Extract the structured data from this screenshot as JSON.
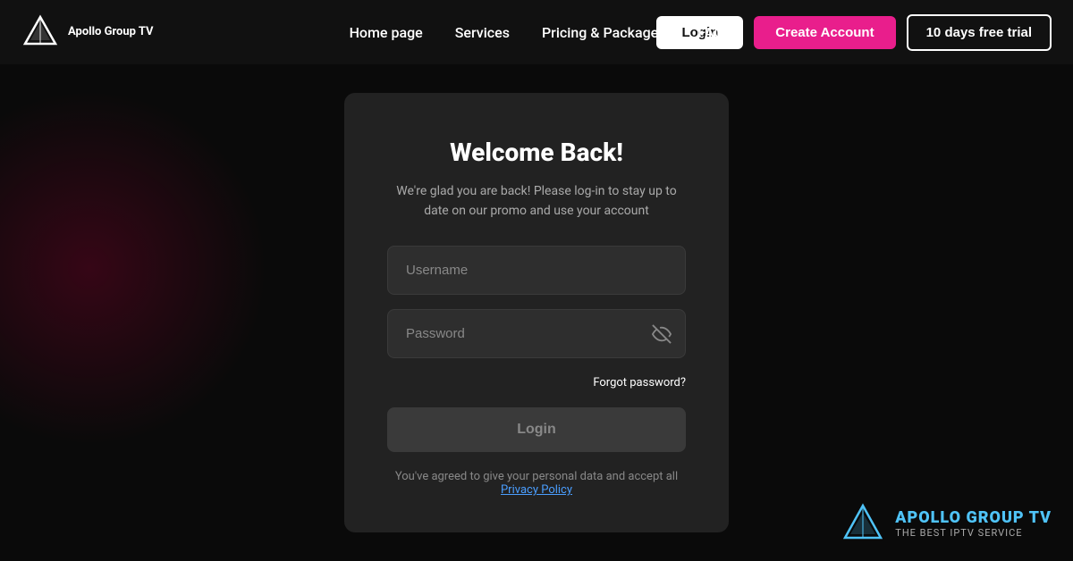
{
  "navbar": {
    "logo_text_line1": "Apollo Group TV",
    "logo_text_line2": "",
    "nav_items": [
      {
        "label": "Home page",
        "id": "home"
      },
      {
        "label": "Services",
        "id": "services"
      },
      {
        "label": "Pricing & Packages",
        "id": "pricing"
      },
      {
        "label": "FAQ",
        "id": "faq"
      }
    ],
    "btn_login": "Login",
    "btn_create": "Create Account",
    "btn_trial": "10 days free trial"
  },
  "login_card": {
    "title": "Welcome Back!",
    "subtitle": "We're glad you are back! Please log-in to stay up to date on our promo and use your account",
    "username_placeholder": "Username",
    "password_placeholder": "Password",
    "forgot_label": "Forgot password?",
    "login_btn": "Login",
    "privacy_text": "You've agreed to give your personal data and accept all",
    "privacy_link": "Privacy Policy"
  },
  "watermark": {
    "name": "APOLLO GROUP TV",
    "tagline": "THE BEST IPTV SERVICE"
  }
}
